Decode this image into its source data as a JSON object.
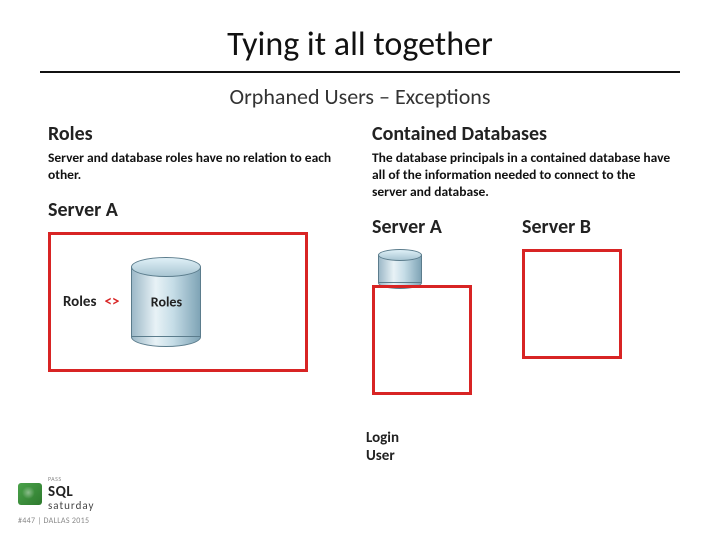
{
  "title": "Tying it all together",
  "subtitle": "Orphaned Users – Exceptions",
  "left": {
    "heading": "Roles",
    "description": "Server and database roles have no relation to each other.",
    "server_label": "Server A",
    "roles_label": "Roles",
    "ne_operator": "<>",
    "db_roles_label": "Roles"
  },
  "right": {
    "heading": "Contained Databases",
    "description": "The database principals in a contained database have all of the information needed to connect to the server and database.",
    "server_a_label": "Server A",
    "server_b_label": "Server B",
    "login_user_line1": "Login",
    "login_user_line2": "User"
  },
  "footer": {
    "logo_top": "SQL",
    "logo_bottom": "saturday",
    "logo_tiny": "PASS",
    "event_tag": "#447 | DALLAS 2015"
  }
}
